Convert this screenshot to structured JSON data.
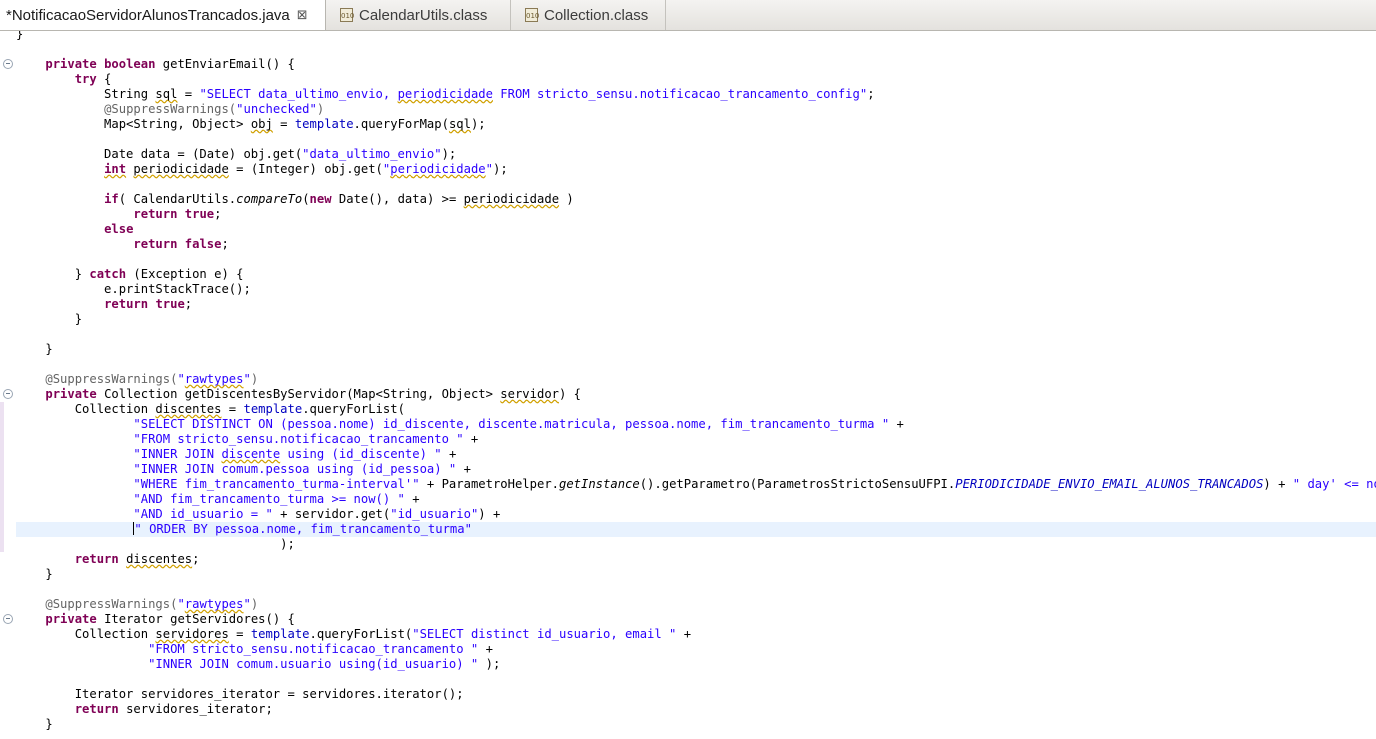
{
  "tabs": [
    {
      "label": "*NotificacaoServidorAlunosTrancados.java",
      "active": true
    },
    {
      "label": "CalendarUtils.class",
      "active": false
    },
    {
      "label": "Collection.class",
      "active": false
    }
  ],
  "tab_icon_text": "010",
  "code_lines": [
    [
      [
        "p",
        "}"
      ]
    ],
    [],
    [
      [
        "p",
        "    "
      ],
      [
        "kw",
        "private"
      ],
      [
        "p",
        " "
      ],
      [
        "kw",
        "boolean"
      ],
      [
        "p",
        " getEnviarEmail() {"
      ]
    ],
    [
      [
        "p",
        "        "
      ],
      [
        "kw",
        "try"
      ],
      [
        "p",
        " {"
      ]
    ],
    [
      [
        "p",
        "            String "
      ],
      [
        "sq",
        "sql"
      ],
      [
        "p",
        " = "
      ],
      [
        "str",
        "\"SELECT data_ultimo_envio, "
      ],
      [
        "str sq",
        "periodicidade"
      ],
      [
        "str",
        " FROM stricto_sensu.notificacao_trancamento_config\""
      ],
      [
        "p",
        ";"
      ]
    ],
    [
      [
        "p",
        "            "
      ],
      [
        "ann",
        "@SuppressWarnings("
      ],
      [
        "str",
        "\"unchecked\""
      ],
      [
        "ann",
        ")"
      ]
    ],
    [
      [
        "p",
        "            Map<String, Object> "
      ],
      [
        "sq",
        "obj"
      ],
      [
        "p",
        " = "
      ],
      [
        "fld",
        "template"
      ],
      [
        "p",
        ".queryForMap("
      ],
      [
        "sq",
        "sql"
      ],
      [
        "p",
        ");"
      ]
    ],
    [],
    [
      [
        "p",
        "            Date data = (Date) obj.get("
      ],
      [
        "str",
        "\"data_ultimo_envio\""
      ],
      [
        "p",
        ");"
      ]
    ],
    [
      [
        "p",
        "            "
      ],
      [
        "kw sq",
        "int"
      ],
      [
        "p",
        " "
      ],
      [
        "sq",
        "periodicidade"
      ],
      [
        "p",
        " = (Integer) obj.get("
      ],
      [
        "str",
        "\""
      ],
      [
        "str sq",
        "periodicidade"
      ],
      [
        "str",
        "\""
      ],
      [
        "p",
        ");"
      ]
    ],
    [],
    [
      [
        "p",
        "            "
      ],
      [
        "kw",
        "if"
      ],
      [
        "p",
        "( CalendarUtils."
      ],
      [
        "ital",
        "compareTo"
      ],
      [
        "p",
        "("
      ],
      [
        "kw",
        "new"
      ],
      [
        "p",
        " Date(), data) >= "
      ],
      [
        "sq",
        "periodicidade"
      ],
      [
        "p",
        " )"
      ]
    ],
    [
      [
        "p",
        "                "
      ],
      [
        "kw",
        "return"
      ],
      [
        "p",
        " "
      ],
      [
        "kw",
        "true"
      ],
      [
        "p",
        ";"
      ]
    ],
    [
      [
        "p",
        "            "
      ],
      [
        "kw",
        "else"
      ]
    ],
    [
      [
        "p",
        "                "
      ],
      [
        "kw",
        "return"
      ],
      [
        "p",
        " "
      ],
      [
        "kw",
        "false"
      ],
      [
        "p",
        ";"
      ]
    ],
    [],
    [
      [
        "p",
        "        } "
      ],
      [
        "kw",
        "catch"
      ],
      [
        "p",
        " (Exception e) {"
      ]
    ],
    [
      [
        "p",
        "            e.printStackTrace();"
      ]
    ],
    [
      [
        "p",
        "            "
      ],
      [
        "kw",
        "return"
      ],
      [
        "p",
        " "
      ],
      [
        "kw",
        "true"
      ],
      [
        "p",
        ";"
      ]
    ],
    [
      [
        "p",
        "        }"
      ]
    ],
    [],
    [
      [
        "p",
        "    }"
      ]
    ],
    [],
    [
      [
        "p",
        "    "
      ],
      [
        "ann",
        "@SuppressWarnings("
      ],
      [
        "str",
        "\""
      ],
      [
        "str sq",
        "rawtypes"
      ],
      [
        "str",
        "\""
      ],
      [
        "ann",
        ")"
      ]
    ],
    [
      [
        "p",
        "    "
      ],
      [
        "kw",
        "private"
      ],
      [
        "p",
        " Collection getDiscentesByServidor(Map<String, Object> "
      ],
      [
        "sq",
        "servidor"
      ],
      [
        "p",
        ") {"
      ]
    ],
    [
      [
        "p",
        "        Collection "
      ],
      [
        "sq",
        "discentes"
      ],
      [
        "p",
        " = "
      ],
      [
        "fld",
        "template"
      ],
      [
        "p",
        ".queryForList("
      ]
    ],
    [
      [
        "p",
        "                "
      ],
      [
        "str",
        "\"SELECT DISTINCT ON (pessoa.nome) id_discente, discente.matricula, pessoa.nome, fim_trancamento_turma \""
      ],
      [
        "p",
        " +"
      ]
    ],
    [
      [
        "p",
        "                "
      ],
      [
        "str",
        "\"FROM stricto_sensu.notificacao_trancamento \""
      ],
      [
        "p",
        " +"
      ]
    ],
    [
      [
        "p",
        "                "
      ],
      [
        "str",
        "\"INNER JOIN "
      ],
      [
        "str sq",
        "discente"
      ],
      [
        "str",
        " using (id_discente) \""
      ],
      [
        "p",
        " +"
      ]
    ],
    [
      [
        "p",
        "                "
      ],
      [
        "str",
        "\"INNER JOIN comum.pessoa using (id_pessoa) \""
      ],
      [
        "p",
        " +"
      ]
    ],
    [
      [
        "p",
        "                "
      ],
      [
        "str",
        "\"WHERE fim_trancamento_turma-interval'\""
      ],
      [
        "p",
        " + ParametroHelper."
      ],
      [
        "ital",
        "getInstance"
      ],
      [
        "p",
        "().getParametro(ParametrosStrictoSensuUFPI."
      ],
      [
        "sfld",
        "PERIODICIDADE_ENVIO_EMAIL_ALUNOS_TRANCADOS"
      ],
      [
        "p",
        ") + "
      ],
      [
        "str",
        "\" day' <= now() \""
      ],
      [
        "p",
        " +"
      ]
    ],
    [
      [
        "p",
        "                "
      ],
      [
        "str",
        "\"AND fim_trancamento_turma >= now() \""
      ],
      [
        "p",
        " +"
      ]
    ],
    [
      [
        "p",
        "                "
      ],
      [
        "str",
        "\"AND id_usuario = \""
      ],
      [
        "p",
        " + servidor.get("
      ],
      [
        "str",
        "\"id_usuario\""
      ],
      [
        "p",
        ") +"
      ]
    ],
    [
      [
        "p",
        "                "
      ],
      [
        "caret",
        ""
      ],
      [
        "str",
        "\" ORDER BY pessoa.nome, fim_trancamento_turma\""
      ]
    ],
    [
      [
        "p",
        "                                    );"
      ]
    ],
    [
      [
        "p",
        "        "
      ],
      [
        "kw",
        "return"
      ],
      [
        "p",
        " "
      ],
      [
        "sq",
        "discentes"
      ],
      [
        "p",
        ";"
      ]
    ],
    [
      [
        "p",
        "    }"
      ]
    ],
    [],
    [
      [
        "p",
        "    "
      ],
      [
        "ann",
        "@SuppressWarnings("
      ],
      [
        "str",
        "\""
      ],
      [
        "str sq",
        "rawtypes"
      ],
      [
        "str",
        "\""
      ],
      [
        "ann",
        ")"
      ]
    ],
    [
      [
        "p",
        "    "
      ],
      [
        "kw",
        "private"
      ],
      [
        "p",
        " Iterator getServidores() {"
      ]
    ],
    [
      [
        "p",
        "        Collection "
      ],
      [
        "sq",
        "servidores"
      ],
      [
        "p",
        " = "
      ],
      [
        "fld",
        "template"
      ],
      [
        "p",
        ".queryForList("
      ],
      [
        "str",
        "\"SELECT distinct id_usuario, email \""
      ],
      [
        "p",
        " +"
      ]
    ],
    [
      [
        "p",
        "                  "
      ],
      [
        "str",
        "\"FROM stricto_sensu.notificacao_trancamento \""
      ],
      [
        "p",
        " +"
      ]
    ],
    [
      [
        "p",
        "                  "
      ],
      [
        "str",
        "\"INNER JOIN comum.usuario using(id_usuario) \""
      ],
      [
        "p",
        " );"
      ]
    ],
    [],
    [
      [
        "p",
        "        Iterator servidores_iterator = servidores.iterator();"
      ]
    ],
    [
      [
        "p",
        "        "
      ],
      [
        "kw",
        "return"
      ],
      [
        "p",
        " servidores_iterator;"
      ]
    ],
    [
      [
        "p",
        "    }"
      ]
    ]
  ],
  "current_line": 33,
  "fold_markers_lines": [
    2,
    24,
    39
  ]
}
